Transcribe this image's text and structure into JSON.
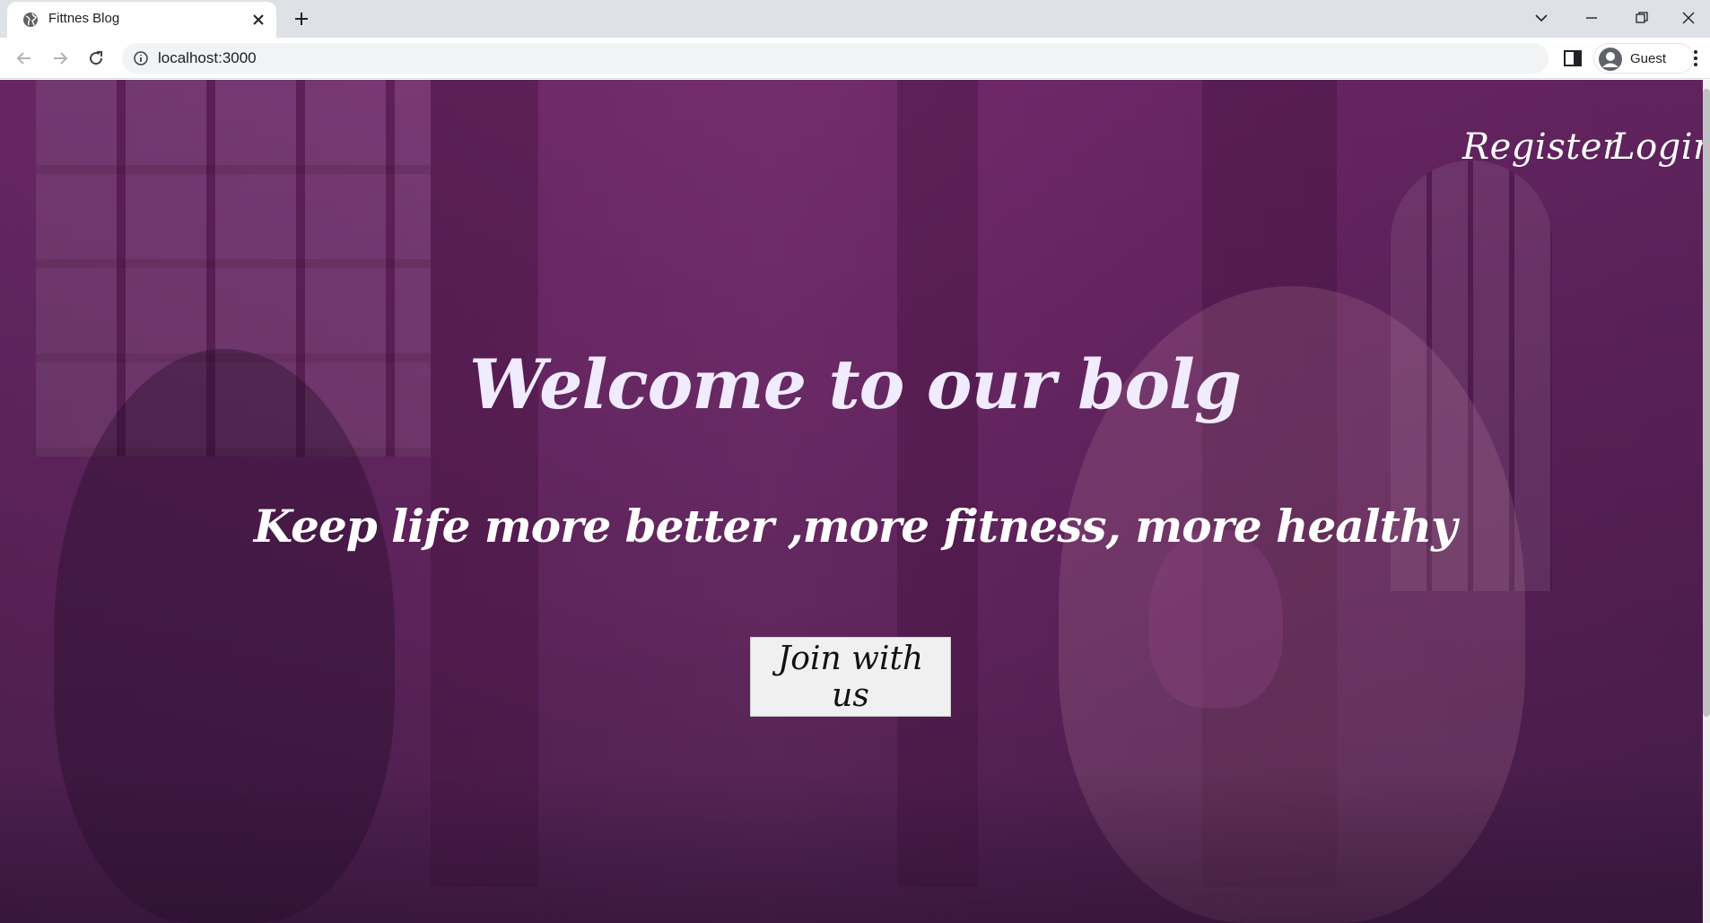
{
  "browser": {
    "tab_title": "Fittnes Blog",
    "url": "localhost:3000",
    "profile_label": "Guest"
  },
  "nav": {
    "register": "Register",
    "login": "Login"
  },
  "hero": {
    "title": "Welcome to our bolg",
    "subtitle": "Keep life more better ,more fitness, more healthy",
    "cta": "Join with us"
  },
  "colors": {
    "overlay": "#6b2e66",
    "title_text": "#f1ebff",
    "button_bg": "#f0f0f0"
  }
}
